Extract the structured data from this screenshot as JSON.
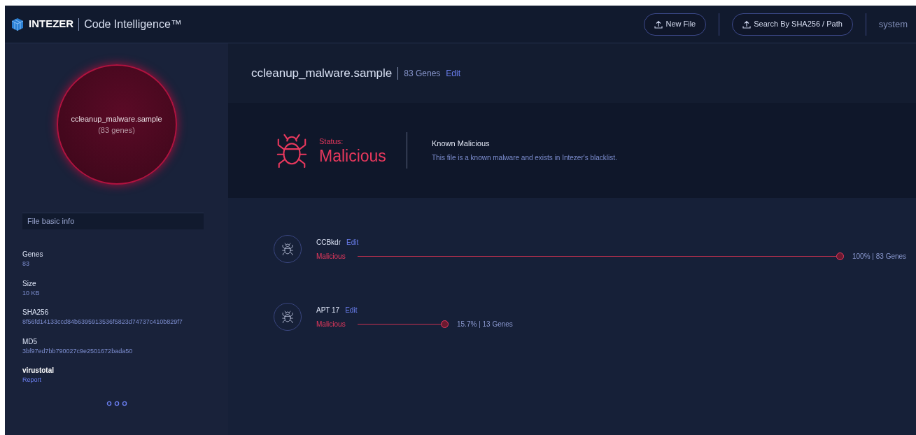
{
  "header": {
    "brand": "INTEZER",
    "product": "Code Intelligence™",
    "buttons": [
      "New File",
      "Search By SHA256 / Path"
    ],
    "user": "system"
  },
  "sidebar": {
    "circle_title": "ccleanup_malware.sample",
    "circle_subtitle": "(83 genes)",
    "section": "File basic info",
    "fields": [
      {
        "label": "Genes",
        "value": "83",
        "kind": "text"
      },
      {
        "label": "Size",
        "value": "10 KB",
        "kind": "text"
      },
      {
        "label": "SHA256",
        "value": "8f56fd14133ccd84b6395913536f5823d74737c410b829f7",
        "kind": "text"
      },
      {
        "label": "MD5",
        "value": "3bf97ed7bb790027c9e2501672bada50",
        "kind": "text"
      },
      {
        "label": "virustotal",
        "value": "Report",
        "kind": "link"
      }
    ]
  },
  "file": {
    "name": "ccleanup_malware.sample",
    "genes": "83 Genes",
    "edit": "Edit"
  },
  "status": {
    "label": "Status:",
    "value": "Malicious",
    "title": "Known Malicious",
    "description": "This file is a known malware and exists in Intezer's blacklist."
  },
  "families": [
    {
      "name": "CCBkdr",
      "edit": "Edit",
      "verdict": "Malicious",
      "reading": "100% | 83 Genes"
    },
    {
      "name": "APT 17",
      "edit": "Edit",
      "verdict": "Malicious",
      "reading": "15.7% | 13 Genes"
    }
  ]
}
